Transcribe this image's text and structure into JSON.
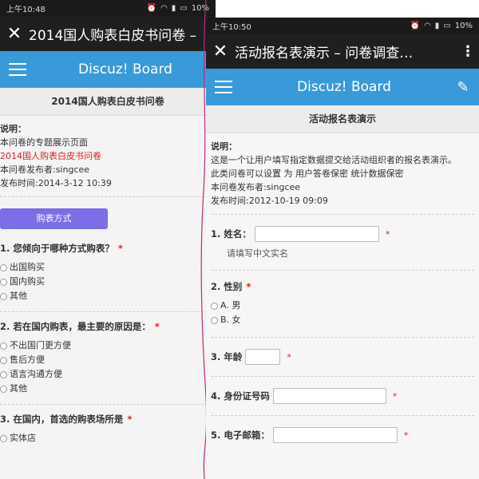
{
  "left": {
    "status": {
      "time": "上午10:48",
      "battery": "10%"
    },
    "titlebar": {
      "title": "2014国人购表白皮书问卷 –"
    },
    "appbar": {
      "brand": "Discuz! Board"
    },
    "subheader": "2014国人购表白皮书问卷",
    "info": {
      "label": "说明：",
      "line1": "本问卷的专题展示页面",
      "line2": "2014国人购表白皮书问卷",
      "publisher": "本问卷发布者:singcee",
      "date": "发布时间:2014-3-12 10:39"
    },
    "section_button": "购表方式",
    "questions": [
      {
        "title": "1. 您倾向于哪种方式购表？",
        "options": [
          "出国购买",
          "国内购买",
          "其他"
        ]
      },
      {
        "title": "2. 若在国内购表，最主要的原因是：",
        "options": [
          "不出国门更方便",
          "售后方便",
          "语言沟通方便",
          "其他"
        ]
      },
      {
        "title": "3. 在国内，首选的购表场所是",
        "options": [
          "实体店"
        ]
      }
    ]
  },
  "right": {
    "status": {
      "time": "上午10:50",
      "battery": "10%"
    },
    "titlebar": {
      "title": "活动报名表演示 – 问卷调查…"
    },
    "appbar": {
      "brand": "Discuz! Board"
    },
    "subheader": "活动报名表演示",
    "info": {
      "label": "说明：",
      "line1": "这是一个让用户填写指定数据提交给活动组织者的报名表演示。",
      "line2": "此类问卷可以设置 为 用户答卷保密 统计数据保密",
      "publisher": "本问卷发布者:singcee",
      "date": "发布时间:2012-10-19 09:09"
    },
    "fields": {
      "name_label": "1. 姓名：",
      "name_hint": "请填写中文实名",
      "gender_label": "2. 性别",
      "gender_options": [
        "A. 男",
        "B. 女"
      ],
      "age_label": "3. 年龄",
      "id_label": "4. 身份证号码",
      "email_label": "5. 电子邮箱："
    }
  },
  "required_mark": "*"
}
